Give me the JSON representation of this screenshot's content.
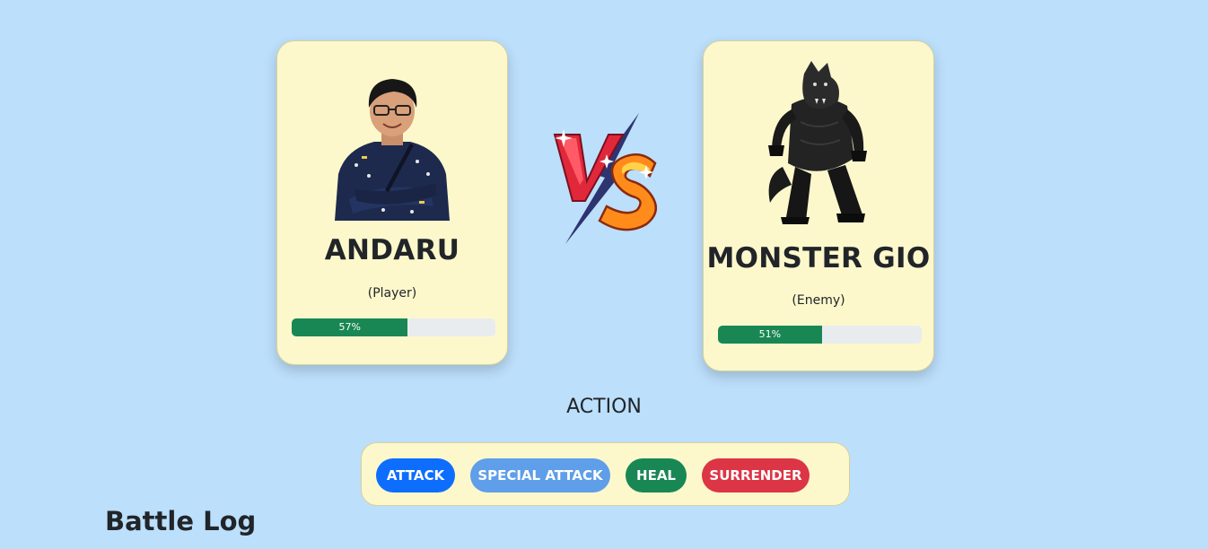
{
  "player": {
    "name": "ANDARU",
    "role": "(Player)",
    "hp_percent": 57,
    "hp_label": "57%"
  },
  "enemy": {
    "name": "MONSTER GIO",
    "role": "(Enemy)",
    "hp_percent": 51,
    "hp_label": "51%"
  },
  "versus": {
    "icon": "vs-emblem"
  },
  "action": {
    "title": "ACTION",
    "buttons": {
      "attack": "ATTACK",
      "special_attack": "SPECIAL ATTACK",
      "heal": "HEAL",
      "surrender": "SURRENDER"
    }
  },
  "log": {
    "title": "Battle Log"
  },
  "colors": {
    "background": "#bcdffb",
    "card": "#fcf8cc",
    "hp_fill": "#198754",
    "attack": "#0d6efd",
    "special_attack": "#5f9ee8",
    "heal": "#198754",
    "surrender": "#dc3545"
  }
}
